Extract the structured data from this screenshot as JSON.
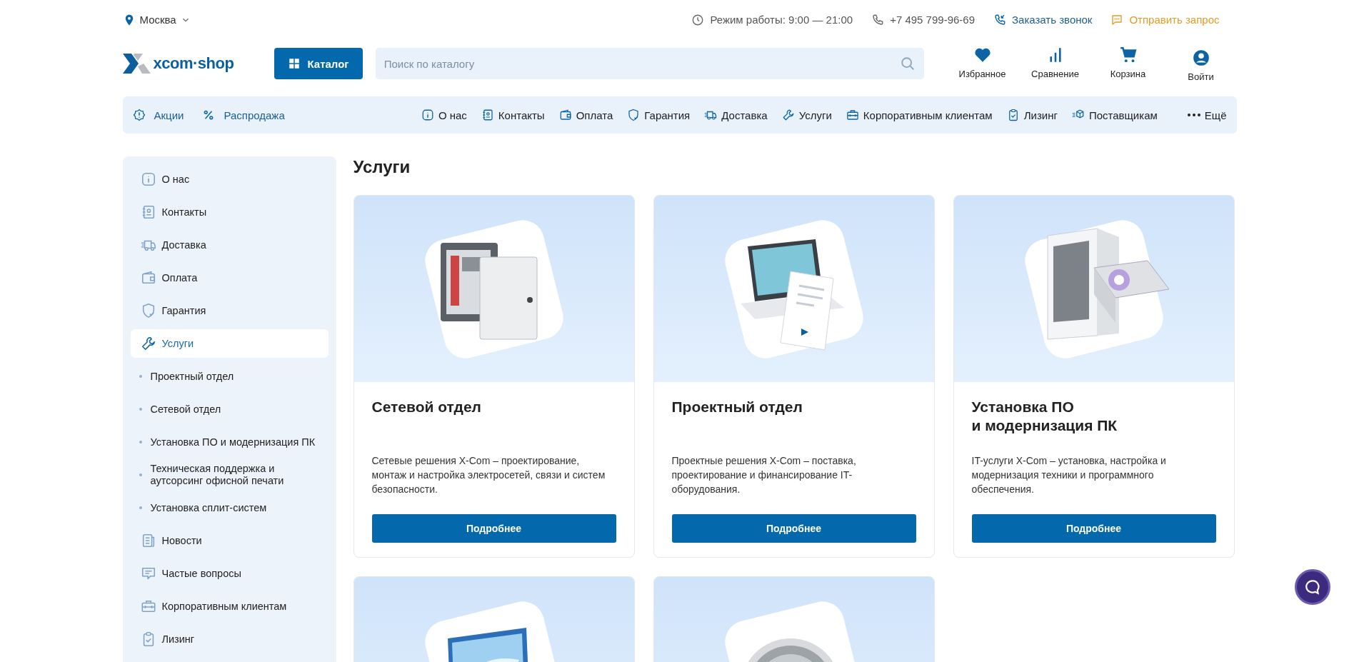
{
  "top_bar": {
    "city": "Москва",
    "hours": "Режим работы: 9:00 — 21:00",
    "phone": "+7 495 799-96-69",
    "callback": "Заказать звонок",
    "request": "Отправить запрос"
  },
  "header": {
    "logo": "xcom·shop",
    "catalog_button": "Каталог",
    "search": {
      "placeholder": "Поиск по каталогу"
    },
    "actions": [
      {
        "label": "Избранное",
        "kind": "heart"
      },
      {
        "label": "Сравнение",
        "kind": "bars"
      },
      {
        "label": "Корзина",
        "kind": "cart"
      },
      {
        "label": "Войти",
        "kind": "user"
      }
    ]
  },
  "nav": {
    "left": [
      {
        "label": "Акции",
        "kind": "badge"
      },
      {
        "label": "Распродажа",
        "kind": "percent"
      }
    ],
    "right": [
      {
        "label": "О нас",
        "kind": "info"
      },
      {
        "label": "Контакты",
        "kind": "contacts"
      },
      {
        "label": "Оплата",
        "kind": "wallet"
      },
      {
        "label": "Гарантия",
        "kind": "shield"
      },
      {
        "label": "Доставка",
        "kind": "truck"
      },
      {
        "label": "Услуги",
        "kind": "wrench"
      },
      {
        "label": "Корпоративным клиентам",
        "kind": "case"
      },
      {
        "label": "Лизинг",
        "kind": "clipboard"
      },
      {
        "label": "Поставщикам",
        "kind": "box"
      }
    ],
    "more": "Ещё"
  },
  "sidebar": {
    "items": [
      {
        "label": "О нас",
        "kind": "info",
        "selected": false
      },
      {
        "label": "Контакты",
        "kind": "contacts",
        "selected": false
      },
      {
        "label": "Доставка",
        "kind": "truck",
        "selected": false
      },
      {
        "label": "Оплата",
        "kind": "wallet",
        "selected": false
      },
      {
        "label": "Гарантия",
        "kind": "shield",
        "selected": false
      },
      {
        "label": "Услуги",
        "kind": "wrench",
        "selected": true
      },
      {
        "label": "Проектный отдел",
        "kind": "sub",
        "selected": false
      },
      {
        "label": "Сетевой отдел",
        "kind": "sub",
        "selected": false
      },
      {
        "label": "Установка ПО и модернизация ПК",
        "kind": "sub",
        "selected": false
      },
      {
        "label": "Техническая поддержка и аутсорсинг офисной печати",
        "kind": "sub",
        "selected": false
      },
      {
        "label": "Установка сплит-систем",
        "kind": "sub",
        "selected": false
      },
      {
        "label": "Новости",
        "kind": "news",
        "selected": false
      },
      {
        "label": "Частые вопросы",
        "kind": "chat",
        "selected": false
      },
      {
        "label": "Корпоративным клиентам",
        "kind": "case",
        "selected": false
      },
      {
        "label": "Лизинг",
        "kind": "clipboard",
        "selected": false
      }
    ]
  },
  "page_title": "Услуги",
  "cards": [
    {
      "kind": "cabinet",
      "title": "Сетевой отдел",
      "description": "Сетевые решения X-Com – проектирование, монтаж и настройка электросетей, связи и систем безопасности.",
      "button": "Подробнее"
    },
    {
      "kind": "laptop",
      "title": "Проектный отдел",
      "description": "Проектные решения X-Com – поставка, проектирование и финансирование IT-оборудования.",
      "button": "Подробнее"
    },
    {
      "kind": "pc",
      "title": "Установка ПО\nи модернизация ПК",
      "description": "IT-услуги X-Com – установка, настройка и модернизация техники и программного обеспечения.",
      "button": "Подробнее"
    },
    {
      "kind": "monitor"
    },
    {
      "kind": "fan"
    }
  ]
}
